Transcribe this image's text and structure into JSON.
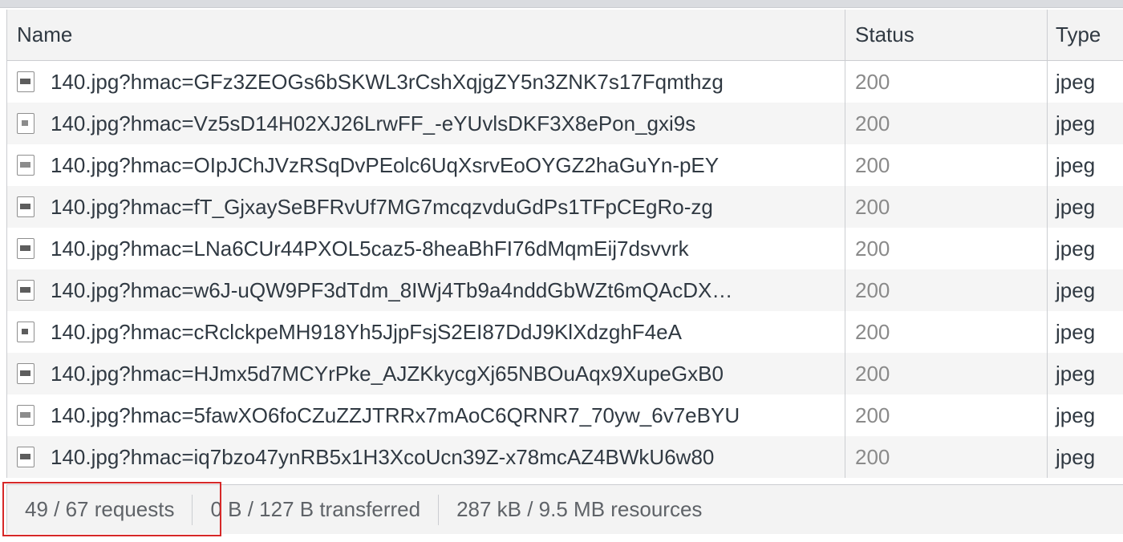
{
  "columns": {
    "name": "Name",
    "status": "Status",
    "type": "Type"
  },
  "rows": [
    {
      "name": "140.jpg?hmac=GFz3ZEOGs6bSKWL3rCshXqjgZY5n3ZNK7s17Fqmthzg",
      "status": "200",
      "type": "jpeg",
      "icon": "image-file-icon"
    },
    {
      "name": "140.jpg?hmac=Vz5sD14H02XJ26LrwFF_-eYUvlsDKF3X8ePon_gxi9s",
      "status": "200",
      "type": "jpeg",
      "icon": "image-file-icon"
    },
    {
      "name": "140.jpg?hmac=OIpJChJVzRSqDvPEolc6UqXsrvEoOYGZ2haGuYn-pEY",
      "status": "200",
      "type": "jpeg",
      "icon": "image-file-icon"
    },
    {
      "name": "140.jpg?hmac=fT_GjxaySeBFRvUf7MG7mcqzvduGdPs1TFpCEgRo-zg",
      "status": "200",
      "type": "jpeg",
      "icon": "image-file-icon"
    },
    {
      "name": "140.jpg?hmac=LNa6CUr44PXOL5caz5-8heaBhFI76dMqmEij7dsvvrk",
      "status": "200",
      "type": "jpeg",
      "icon": "image-file-icon"
    },
    {
      "name": "140.jpg?hmac=w6J-uQW9PF3dTdm_8IWj4Tb9a4nddGbWZt6mQAcDX…",
      "status": "200",
      "type": "jpeg",
      "icon": "image-file-icon"
    },
    {
      "name": "140.jpg?hmac=cRclckpeMH918Yh5JjpFsjS2EI87DdJ9KlXdzghF4eA",
      "status": "200",
      "type": "jpeg",
      "icon": "image-file-icon"
    },
    {
      "name": "140.jpg?hmac=HJmx5d7MCYrPke_AJZKkycgXj65NBOuAqx9XupeGxB0",
      "status": "200",
      "type": "jpeg",
      "icon": "image-file-icon"
    },
    {
      "name": "140.jpg?hmac=5fawXO6foCZuZZJTRRx7mAoC6QRNR7_70yw_6v7eBYU",
      "status": "200",
      "type": "jpeg",
      "icon": "image-file-icon"
    },
    {
      "name": "140.jpg?hmac=iq7bzo47ynRB5x1H3XcoUcn39Z-x78mcAZ4BWkU6w80",
      "status": "200",
      "type": "jpeg",
      "icon": "image-file-icon"
    }
  ],
  "status_bar": {
    "requests": "49 / 67 requests",
    "transferred": "0 B / 127 B transferred",
    "resources": "287 kB / 9.5 MB resources"
  },
  "colors": {
    "highlight": "#d62828",
    "status_text": "#8a8a8a",
    "header_bg": "#f3f3f3"
  }
}
